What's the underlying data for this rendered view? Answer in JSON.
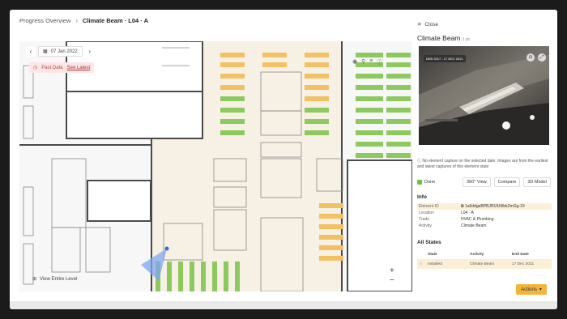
{
  "breadcrumb": {
    "root": "Progress Overview",
    "separator": "›",
    "current": "Climate Beam · L04 · A"
  },
  "map": {
    "date_prev": "‹",
    "date": "07 Jan 2022",
    "date_next": "›",
    "past_data_label": "Past Data",
    "see_latest_label": "See Latest",
    "view_entire_level": "View Entire Level",
    "zoom_in": "+",
    "zoom_out": "−",
    "colors": {
      "installed": "#8dc95e",
      "planned": "#f3c063",
      "floor": "#f7f7f7"
    }
  },
  "panel": {
    "close_label": "Close",
    "title": "Climate Beam",
    "qty": "1 pc",
    "photo_tag": "DEB 2017 - 17 DEC 2021",
    "note": "No element capture on the selected date. Images are from the earliest and latest captures of this element state",
    "status": "Done",
    "status_color": "#6cbf4b",
    "buttons": [
      "360° View",
      "Compare",
      "3D Model"
    ],
    "info_title": "Info",
    "info": [
      {
        "key": "Element ID",
        "value": "1a6ddgeBPBJR1fU9ibkZmGg-19"
      },
      {
        "key": "Location",
        "value": "L04 · A"
      },
      {
        "key": "Trade",
        "value": "HVAC & Plumbing"
      },
      {
        "key": "Activity",
        "value": "Climate Beam"
      }
    ],
    "states_title": "All States",
    "states_headers": [
      "State",
      "Activity",
      "End Date"
    ],
    "states_rows": [
      {
        "state": "Installed",
        "activity": "Climate Beam",
        "end_date": "17 Dec 2021"
      }
    ],
    "actions_label": "Actions",
    "accent": "#f2b43b"
  }
}
